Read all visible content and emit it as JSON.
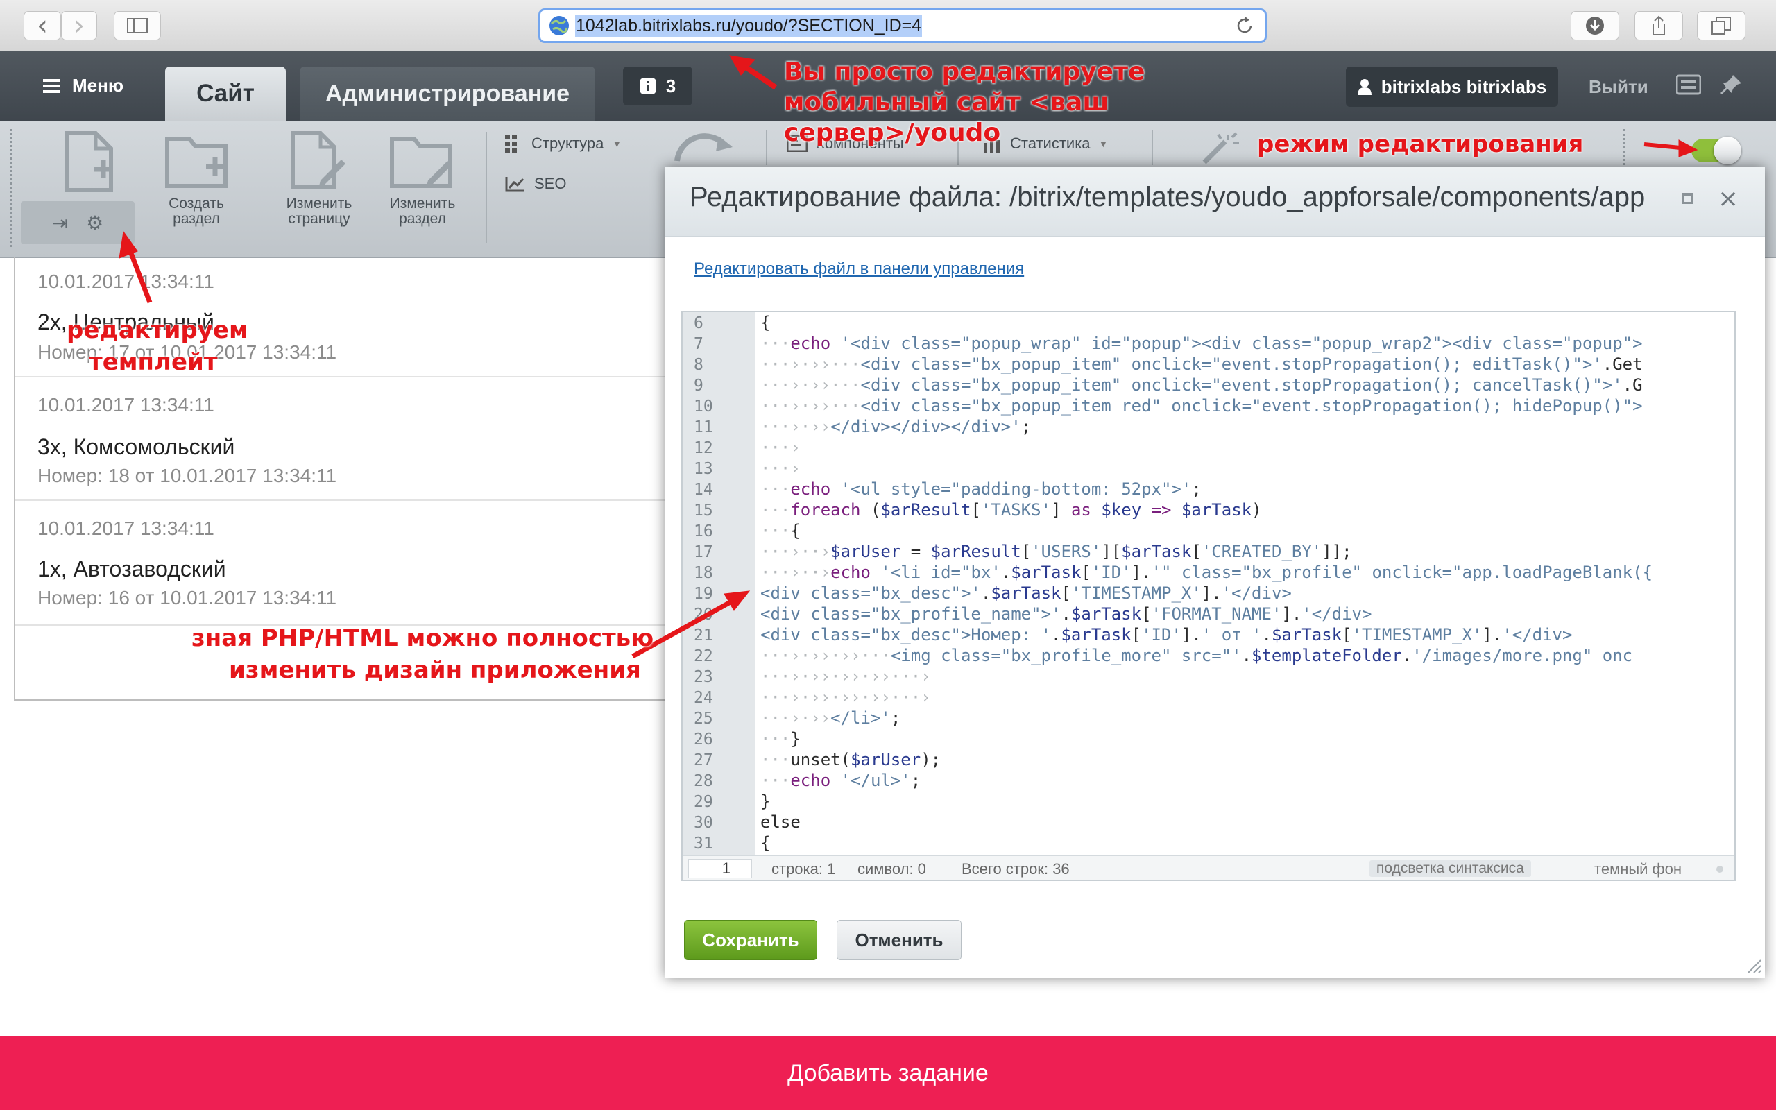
{
  "browser": {
    "url": "1042lab.bitrixlabs.ru/youdo/?SECTION_ID=4",
    "back_glyph": "‹",
    "forward_glyph": "›"
  },
  "admin_panel": {
    "menu_label": "Меню",
    "tab_site": "Сайт",
    "tab_admin": "Администрирование",
    "notifications_count": "3",
    "user_name": "bitrixlabs bitrixlabs",
    "logout_label": "Выйти",
    "toolbar": {
      "create_section": "Создать раздел",
      "edit_page": "Изменить страницу",
      "edit_section": "Изменить раздел",
      "structure": "Структура",
      "seo": "SEO",
      "components": "Компоненты",
      "statistics": "Статистика"
    }
  },
  "list": [
    {
      "date": "10.01.2017 13:34:11",
      "title": "2х, Центральный",
      "subtitle": "Номер: 17 от 10.01.2017 13:34:11"
    },
    {
      "date": "10.01.2017 13:34:11",
      "title": "3х, Комсомольский",
      "subtitle": "Номер: 18 от 10.01.2017 13:34:11"
    },
    {
      "date": "10.01.2017 13:34:11",
      "title": "1х, Автозаводский",
      "subtitle": "Номер: 16 от 10.01.2017 13:34:11"
    }
  ],
  "dialog": {
    "title": "Редактирование файла: /bitrix/templates/youdo_appforsale/components/app",
    "edit_link": "Редактировать файл в панели управления",
    "status": {
      "line_box": "1",
      "line": "строка: 1",
      "symbol": "символ: 0",
      "total": "Всего строк: 36",
      "syntax": "подсветка синтаксиса",
      "dark": "темный фон"
    },
    "save_label": "Сохранить",
    "cancel_label": "Отменить"
  },
  "code_lines": [
    {
      "n": "6"
    },
    {
      "n": "7"
    },
    {
      "n": "8"
    },
    {
      "n": "9"
    },
    {
      "n": "10"
    },
    {
      "n": "11"
    },
    {
      "n": "12"
    },
    {
      "n": "13"
    },
    {
      "n": "14"
    },
    {
      "n": "15"
    },
    {
      "n": "16"
    },
    {
      "n": "17"
    },
    {
      "n": "18"
    },
    {
      "n": "19"
    },
    {
      "n": "20"
    },
    {
      "n": "21"
    },
    {
      "n": "22"
    },
    {
      "n": "23"
    },
    {
      "n": "24"
    },
    {
      "n": "25"
    },
    {
      "n": "26"
    },
    {
      "n": "27"
    },
    {
      "n": "28"
    },
    {
      "n": "29"
    },
    {
      "n": "30"
    },
    {
      "n": "31"
    }
  ],
  "add_task_label": "Добавить задание",
  "annotations": {
    "mobile": "Вы просто редактируете мобильный сайт <ваш сервер>/youdo",
    "edit_mode": "режим редактирования",
    "template_1": "редактируем",
    "template_2": "темплейт",
    "php_1": "зная PHP/HTML можно полностью",
    "php_2": "изменить дизайн приложения"
  },
  "colors": {
    "accent_red": "#ee1f53",
    "save_green": "#6aab25",
    "annotation_red": "#e5161a"
  }
}
